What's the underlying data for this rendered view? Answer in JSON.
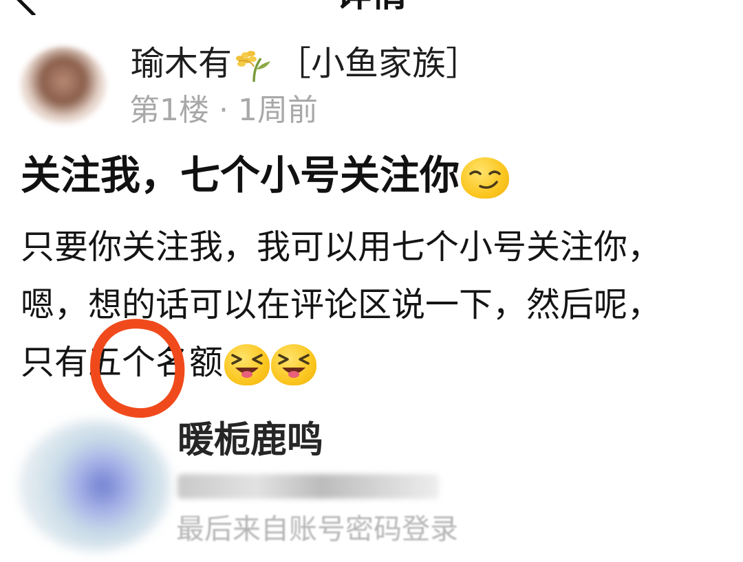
{
  "header": {
    "title": "详情"
  },
  "post": {
    "author_name": "瑜木有",
    "author_tag": "［小鱼家族］",
    "floor": "第1楼",
    "separator": "·",
    "time": "1周前",
    "title": "关注我，七个小号关注你",
    "title_emoji": "smirk-emoji-icon",
    "body_lines": [
      "只要你关注我，我可以用七个小号关注你，",
      "嗯，想的话可以在评论区说一下，然后呢，",
      "只有五个名额"
    ],
    "body_emojis": [
      "laughing-emoji-icon",
      "laughing-emoji-icon"
    ]
  },
  "commenter": {
    "name": "暖栀鹿鸣",
    "subtitle": "最后来自账号密码登录"
  },
  "colors": {
    "annotation_circle": "#f04a1c",
    "emoji_yellow": "#fbc620",
    "meta_gray": "#a8a8a8"
  }
}
